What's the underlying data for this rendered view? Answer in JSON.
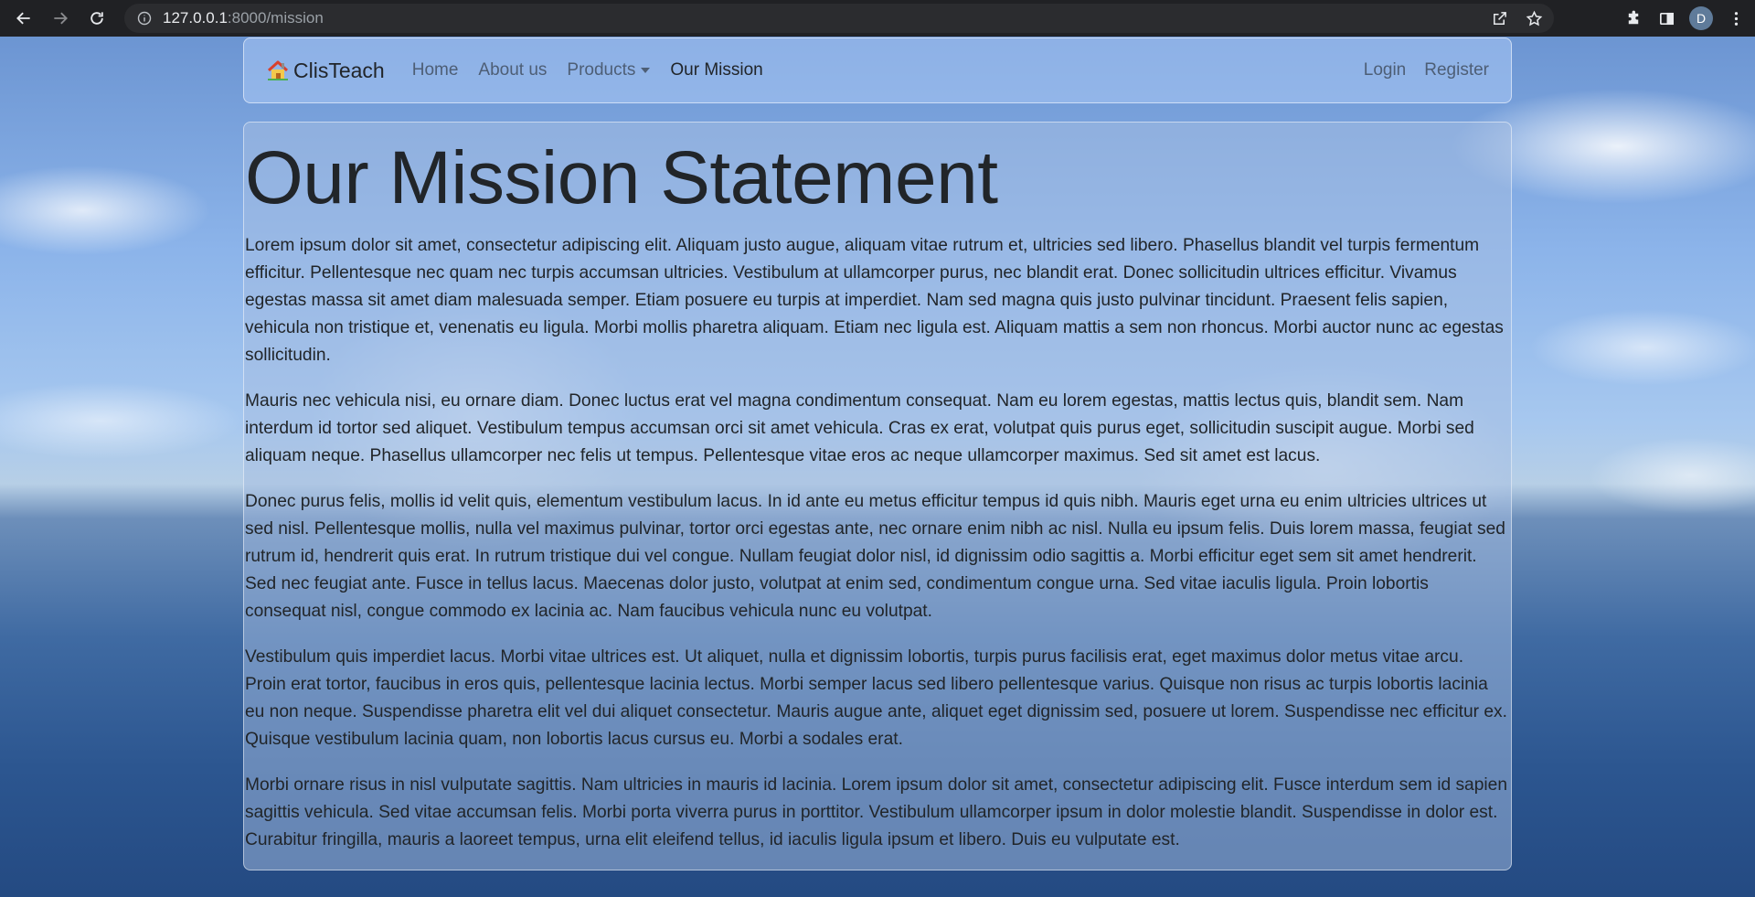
{
  "browser": {
    "url_host": "127.0.0.1",
    "url_path": ":8000/mission",
    "profile_initial": "D"
  },
  "navbar": {
    "brand": "ClisTeach",
    "links": [
      {
        "label": "Home"
      },
      {
        "label": "About us"
      },
      {
        "label": "Products"
      },
      {
        "label": "Our Mission"
      }
    ],
    "login": "Login",
    "register": "Register"
  },
  "main": {
    "title": "Our Mission Statement",
    "paragraphs": [
      "Lorem ipsum dolor sit amet, consectetur adipiscing elit. Aliquam justo augue, aliquam vitae rutrum et, ultricies sed libero. Phasellus blandit vel turpis fermentum efficitur. Pellentesque nec quam nec turpis accumsan ultricies. Vestibulum at ullamcorper purus, nec blandit erat. Donec sollicitudin ultrices efficitur. Vivamus egestas massa sit amet diam malesuada semper. Etiam posuere eu turpis at imperdiet. Nam sed magna quis justo pulvinar tincidunt. Praesent felis sapien, vehicula non tristique et, venenatis eu ligula. Morbi mollis pharetra aliquam. Etiam nec ligula est. Aliquam mattis a sem non rhoncus. Morbi auctor nunc ac egestas sollicitudin.",
      "Mauris nec vehicula nisi, eu ornare diam. Donec luctus erat vel magna condimentum consequat. Nam eu lorem egestas, mattis lectus quis, blandit sem. Nam interdum id tortor sed aliquet. Vestibulum tempus accumsan orci sit amet vehicula. Cras ex erat, volutpat quis purus eget, sollicitudin suscipit augue. Morbi sed aliquam neque. Phasellus ullamcorper nec felis ut tempus. Pellentesque vitae eros ac neque ullamcorper maximus. Sed sit amet est lacus.",
      "Donec purus felis, mollis id velit quis, elementum vestibulum lacus. In id ante eu metus efficitur tempus id quis nibh. Mauris eget urna eu enim ultricies ultrices ut sed nisl. Pellentesque mollis, nulla vel maximus pulvinar, tortor orci egestas ante, nec ornare enim nibh ac nisl. Nulla eu ipsum felis. Duis lorem massa, feugiat sed rutrum id, hendrerit quis erat. In rutrum tristique dui vel congue. Nullam feugiat dolor nisl, id dignissim odio sagittis a. Morbi efficitur eget sem sit amet hendrerit. Sed nec feugiat ante. Fusce in tellus lacus. Maecenas dolor justo, volutpat at enim sed, condimentum congue urna. Sed vitae iaculis ligula. Proin lobortis consequat nisl, congue commodo ex lacinia ac. Nam faucibus vehicula nunc eu volutpat.",
      "Vestibulum quis imperdiet lacus. Morbi vitae ultrices est. Ut aliquet, nulla et dignissim lobortis, turpis purus facilisis erat, eget maximus dolor metus vitae arcu. Proin erat tortor, faucibus in eros quis, pellentesque lacinia lectus. Morbi semper lacus sed libero pellentesque varius. Quisque non risus ac turpis lobortis lacinia eu non neque. Suspendisse pharetra elit vel dui aliquet consectetur. Mauris augue ante, aliquet eget dignissim sed, posuere ut lorem. Suspendisse nec efficitur ex. Quisque vestibulum lacinia quam, non lobortis lacus cursus eu. Morbi a sodales erat.",
      "Morbi ornare risus in nisl vulputate sagittis. Nam ultricies in mauris id lacinia. Lorem ipsum dolor sit amet, consectetur adipiscing elit. Fusce interdum sem id sapien sagittis vehicula. Sed vitae accumsan felis. Morbi porta viverra purus in porttitor. Vestibulum ullamcorper ipsum in dolor molestie blandit. Suspendisse in dolor est. Curabitur fringilla, mauris a laoreet tempus, urna elit eleifend tellus, id iaculis ligula ipsum et libero. Duis eu vulputate est."
    ]
  },
  "icons": {
    "back": "arrow-left-icon",
    "forward": "arrow-right-icon",
    "reload": "reload-icon",
    "site_info": "info-icon",
    "share": "share-icon",
    "bookmark": "star-icon",
    "extensions": "puzzle-icon",
    "side_panel": "side-panel-icon",
    "menu": "kebab-menu-icon",
    "brand_logo": "house-icon"
  }
}
